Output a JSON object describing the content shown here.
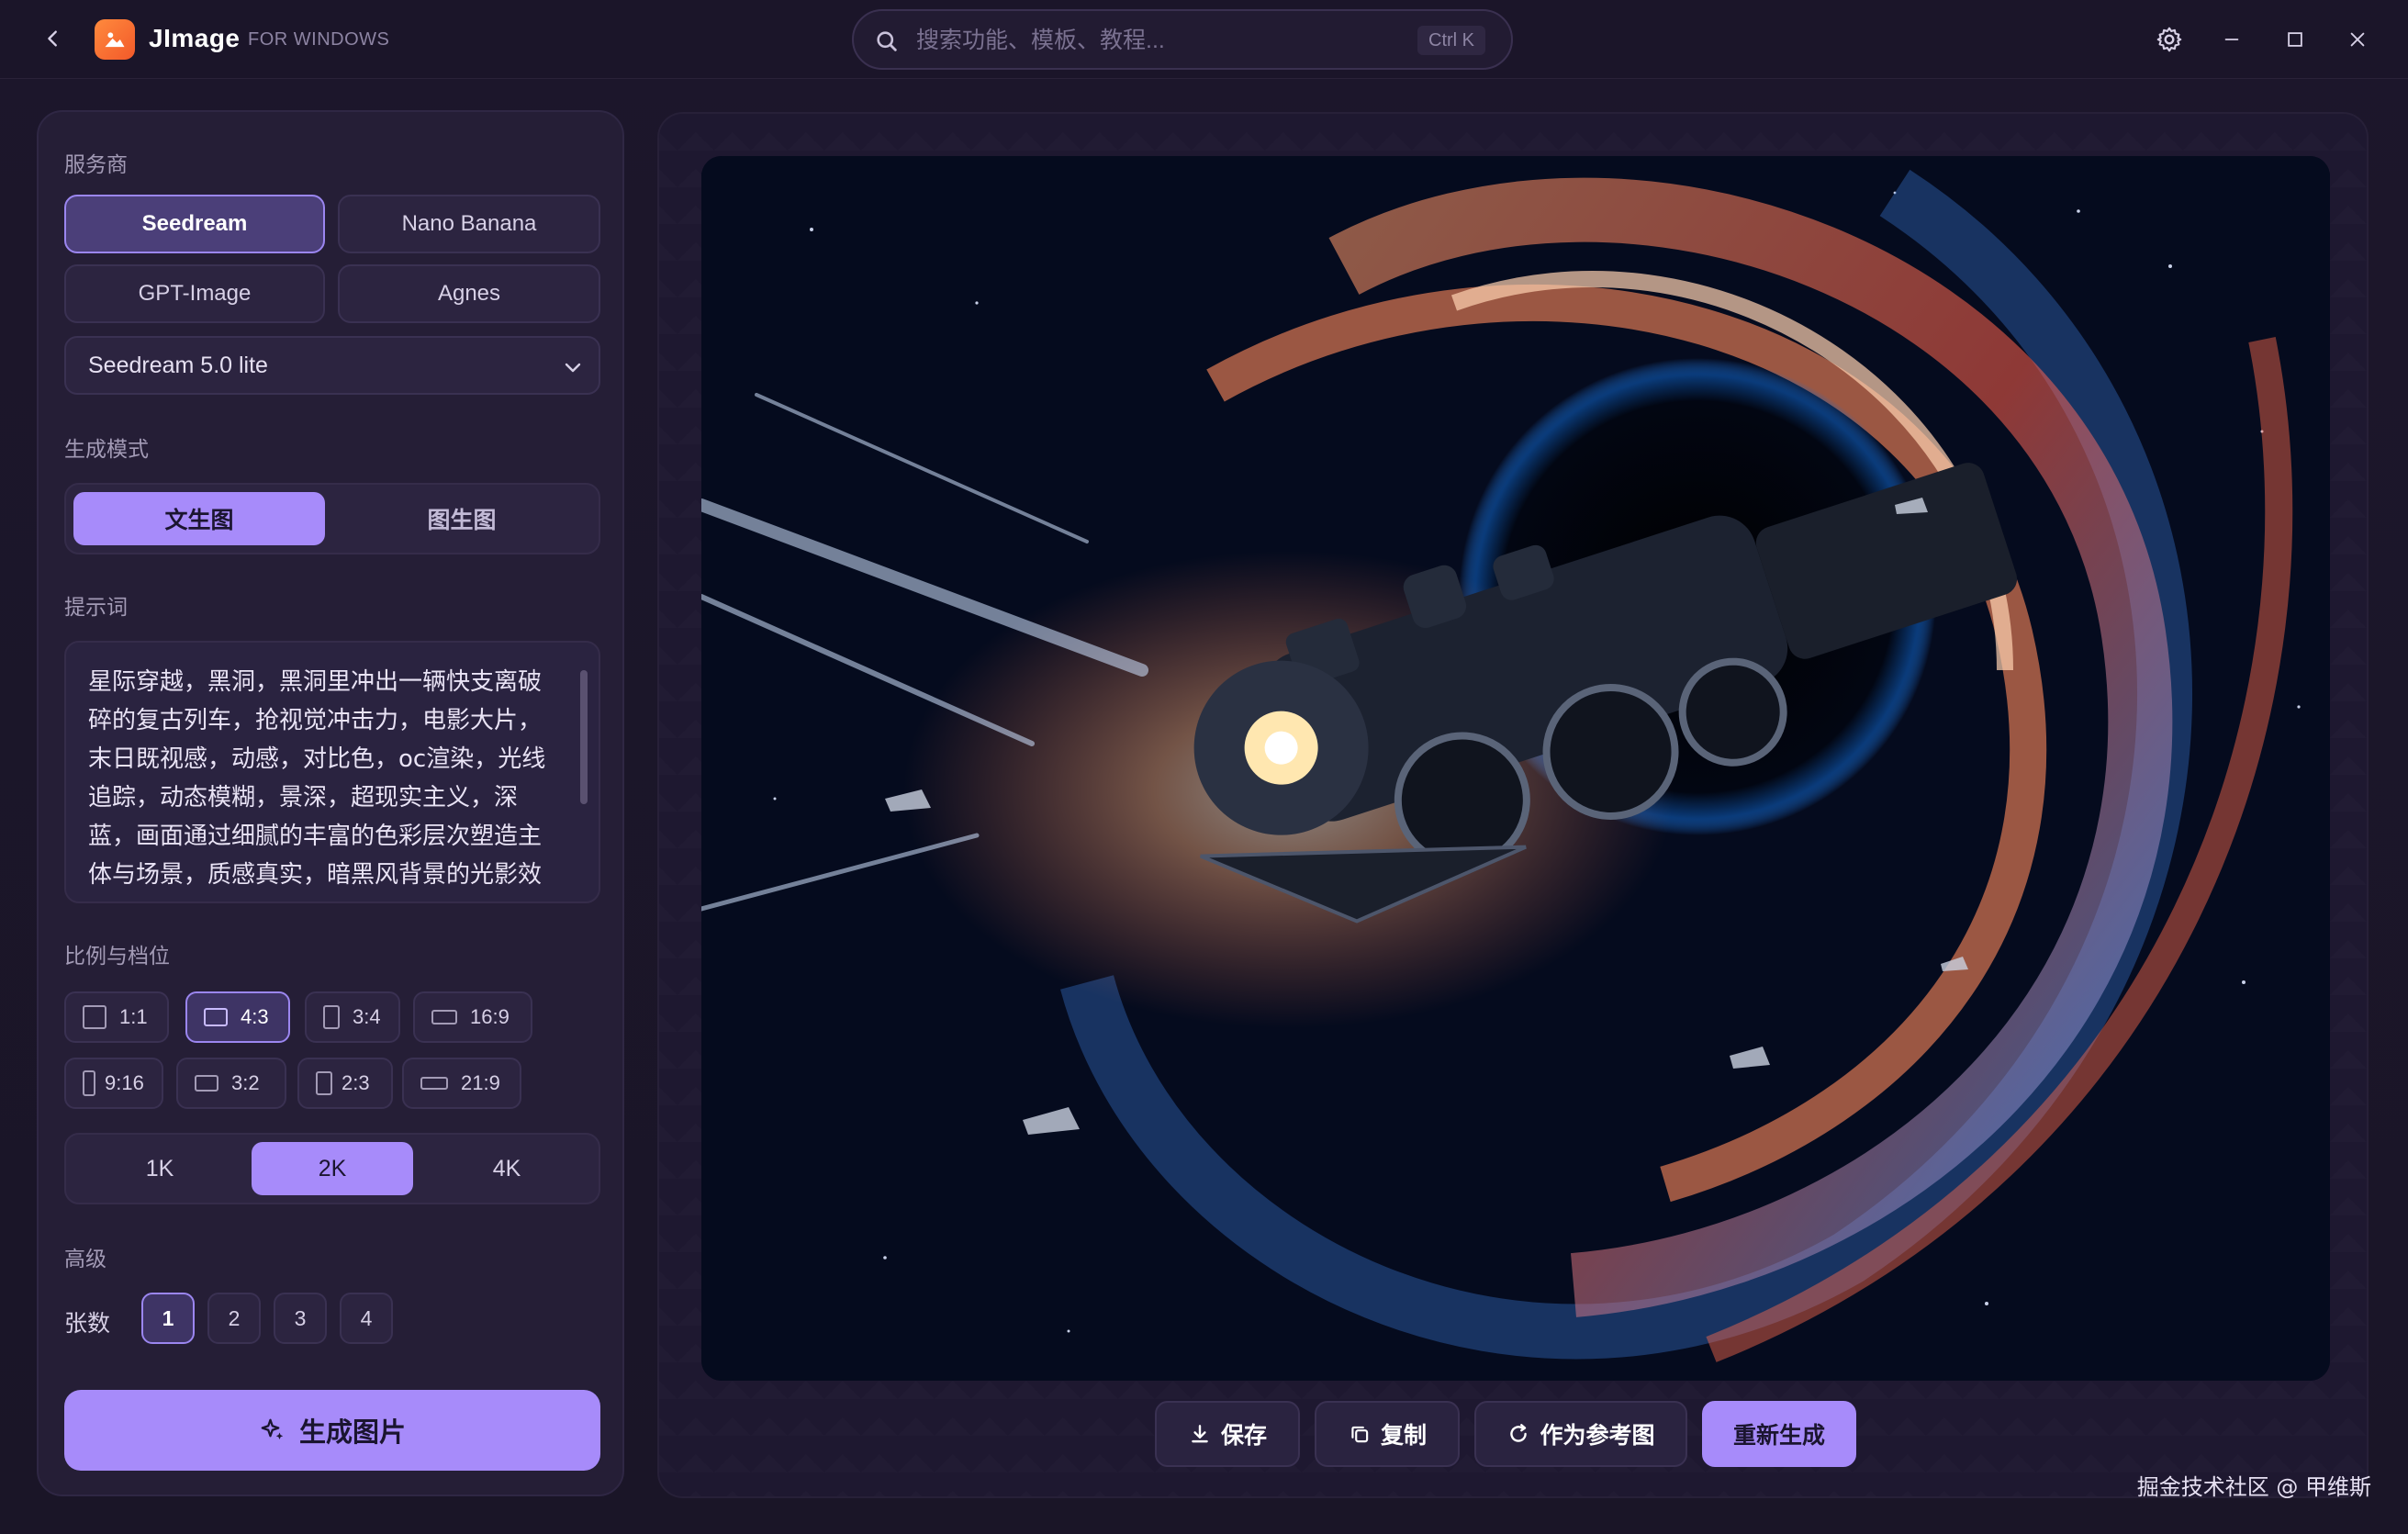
{
  "titlebar": {
    "app_name": "JImage",
    "app_subtitle": "FOR WINDOWS",
    "search_placeholder": "搜索功能、模板、教程...",
    "search_shortcut": "Ctrl K"
  },
  "sidebar": {
    "provider_label": "服务商",
    "providers": [
      "Seedream",
      "Nano Banana",
      "GPT-Image",
      "Agnes"
    ],
    "selected_provider": "Seedream",
    "model_select_value": "Seedream 5.0 lite",
    "mode_label": "生成模式",
    "modes": [
      "文生图",
      "图生图"
    ],
    "selected_mode": "文生图",
    "prompt_label": "提示词",
    "prompt_text": "星际穿越，黑洞，黑洞里冲出一辆快支离破碎的复古列车，抢视觉冲击力，电影大片，末日既视感，动感，对比色，oc渲染，光线追踪，动态模糊，景深，超现实主义，深蓝，画面通过细腻的丰富的色彩层次塑造主体与场景，质感真实，暗黑风背景的光影效",
    "ratio_label": "比例与档位",
    "ratios": [
      "1:1",
      "4:3",
      "3:4",
      "16:9",
      "9:16",
      "3:2",
      "2:3",
      "21:9"
    ],
    "selected_ratio": "4:3",
    "resolutions": [
      "1K",
      "2K",
      "4K"
    ],
    "selected_resolution": "2K",
    "advanced_label": "高级",
    "count_label": "张数",
    "counts": [
      "1",
      "2",
      "3",
      "4"
    ],
    "selected_count": "1",
    "generate_label": "生成图片"
  },
  "canvas": {
    "actions": {
      "save": "保存",
      "copy": "复制",
      "as_reference": "作为参考图",
      "regenerate": "重新生成"
    }
  },
  "watermark": "掘金技术社区 @ 甲维斯",
  "colors": {
    "accent": "#a78bfa",
    "background": "#1a1527",
    "panel": "#251e36",
    "logo": "#f2592a"
  }
}
